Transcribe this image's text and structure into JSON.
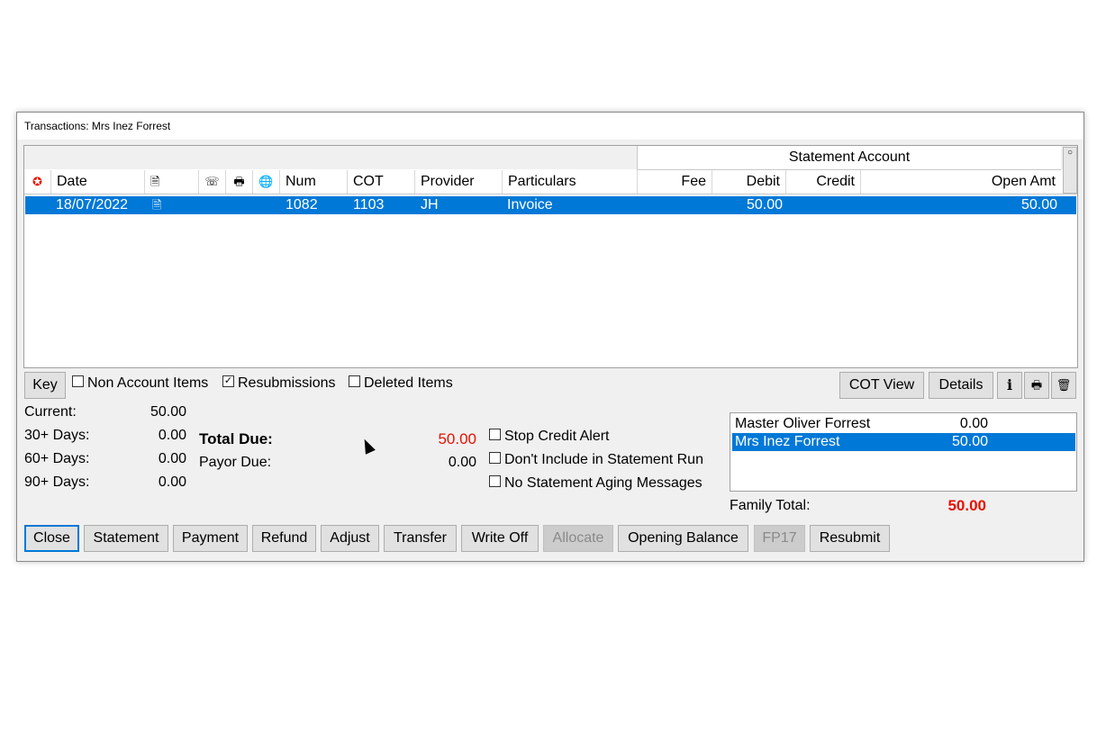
{
  "window": {
    "title": "Transactions: Mrs Inez Forrest"
  },
  "grid": {
    "band_label": "Statement Account",
    "columns": {
      "alert_icon": "✪",
      "date": "Date",
      "doc_icon": "🗎",
      "phone_icon": "☏",
      "print_icon": "🖶",
      "globe_icon": "🌐",
      "num": "Num",
      "cot": "COT",
      "provider": "Provider",
      "particulars": "Particulars",
      "fee": "Fee",
      "debit": "Debit",
      "credit": "Credit",
      "open_amt": "Open Amt"
    },
    "rows": [
      {
        "date": "18/07/2022",
        "doc": "🗎",
        "num": "1082",
        "cot": "1103",
        "provider": "JH",
        "particulars": "Invoice",
        "fee": "",
        "debit": "50.00",
        "credit": "",
        "open_amt": "50.00"
      }
    ],
    "scroll_glyph": "○"
  },
  "options": {
    "key_label": "Key",
    "non_account": {
      "label": "Non Account Items",
      "checked": false,
      "mark": ""
    },
    "resubmissions": {
      "label": "Resubmissions",
      "checked": true,
      "mark": "✓"
    },
    "deleted": {
      "label": "Deleted Items",
      "checked": false,
      "mark": ""
    },
    "cot_view_label": "COT View",
    "details_label": "Details",
    "info_icon": "i",
    "print_icon": "🖶",
    "trash_icon": "🗑"
  },
  "aging": {
    "current_label": "Current:",
    "current": "50.00",
    "d30_label": "30+ Days:",
    "d30": "0.00",
    "d60_label": "60+ Days:",
    "d60": "0.00",
    "d90_label": "90+ Days:",
    "d90": "0.00"
  },
  "totals": {
    "total_due_label": "Total Due:",
    "total_due": "50.00",
    "payor_due_label": "Payor Due:",
    "payor_due": "0.00",
    "total_color": "#e81000"
  },
  "flags": {
    "stop_credit": {
      "label": "Stop Credit Alert",
      "checked": false
    },
    "dont_include": {
      "label": "Don't Include in Statement Run",
      "checked": false
    },
    "no_aging": {
      "label": "No Statement Aging Messages",
      "checked": false
    }
  },
  "family": {
    "members": [
      {
        "name": "Master Oliver Forrest",
        "amount": "0.00",
        "selected": false
      },
      {
        "name": "Mrs Inez Forrest",
        "amount": "50.00",
        "selected": true
      }
    ],
    "total_label": "Family Total:",
    "total": "50.00"
  },
  "actions": {
    "close": "Close",
    "statement": "Statement",
    "payment": "Payment",
    "refund": "Refund",
    "adjust": "Adjust",
    "transfer": "Transfer",
    "write_off": "Write Off",
    "allocate": "Allocate",
    "opening_balance": "Opening Balance",
    "fp17": "FP17",
    "resubmit": "Resubmit"
  },
  "colors": {
    "selection": "#0078d7",
    "alert_red": "#e81000"
  }
}
